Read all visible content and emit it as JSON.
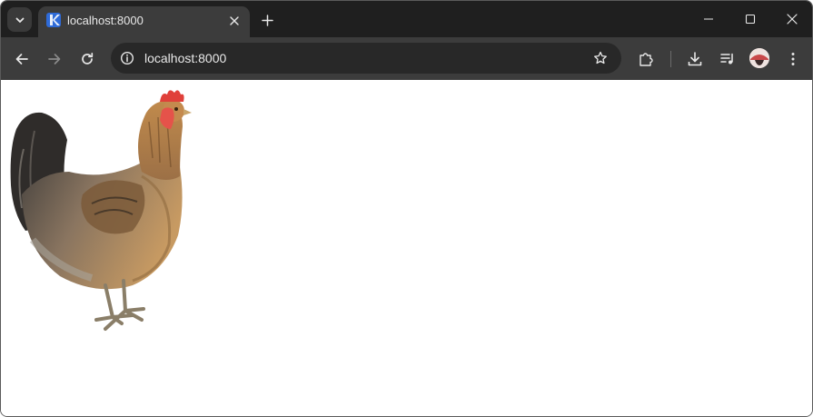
{
  "tab": {
    "title": "localhost:8000"
  },
  "omnibox": {
    "url": "localhost:8000"
  },
  "colors": {
    "tabstrip_bg": "#1f1f1f",
    "toolbar_bg": "#3c3c3c",
    "omnibox_bg": "#282828",
    "favicon": "#2f6bd8",
    "page_bg": "#ffffff"
  },
  "icons": {
    "tab_search": "chevron-down-icon",
    "tab_close": "close-icon",
    "new_tab": "plus-icon",
    "minimize": "minimize-icon",
    "maximize": "maximize-icon",
    "close_window": "close-icon",
    "back": "arrow-left-icon",
    "forward": "arrow-right-icon",
    "reload": "reload-icon",
    "site_info": "info-icon",
    "bookmark": "star-icon",
    "extensions": "puzzle-icon",
    "downloads": "download-icon",
    "media": "media-queue-icon",
    "profile": "avatar",
    "menu": "kebab-menu-icon"
  },
  "page": {
    "image": "rooster-image"
  }
}
